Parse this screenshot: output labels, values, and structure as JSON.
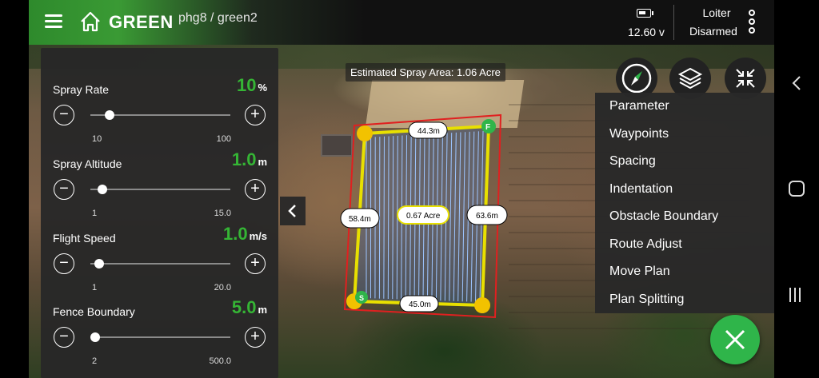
{
  "app": {
    "brand": "GREEN",
    "breadcrumb": "phg8 / green2"
  },
  "status": {
    "voltage": "12.60 v",
    "mode": "Loiter",
    "armed_state": "Disarmed"
  },
  "map": {
    "spray_area": "Estimated Spray Area:  1.06 Acre",
    "plan": {
      "area": "0.67 Acre",
      "top_edge": "44.3m",
      "left_edge": "58.4m",
      "right_edge": "63.6m",
      "bottom_edge": "45.0m",
      "marker_start": "F",
      "marker_end": "S"
    }
  },
  "settings": [
    {
      "label": "Spray Rate",
      "value": "10",
      "unit": "%",
      "min": "10",
      "max": "100",
      "level": 0.1
    },
    {
      "label": "Spray Altitude",
      "value": "1.0",
      "unit": "m",
      "min": "1",
      "max": "15.0",
      "level": 0.05
    },
    {
      "label": "Flight Speed",
      "value": "1.0",
      "unit": "m/s",
      "min": "1",
      "max": "20.0",
      "level": 0.03
    },
    {
      "label": "Fence Boundary",
      "value": "5.0",
      "unit": "m",
      "min": "2",
      "max": "500.0",
      "level": 0.0
    }
  ],
  "menu": {
    "items": [
      "Parameter",
      "Waypoints",
      "Spacing",
      "Indentation",
      "Obstacle Boundary",
      "Route Adjust",
      "Move Plan",
      "Plan Splitting"
    ]
  },
  "colors": {
    "accent": "#35b535",
    "fab": "#2fb54a",
    "boundary": "#e8e000",
    "fence": "#e02020",
    "route": "#6aa8ff"
  }
}
